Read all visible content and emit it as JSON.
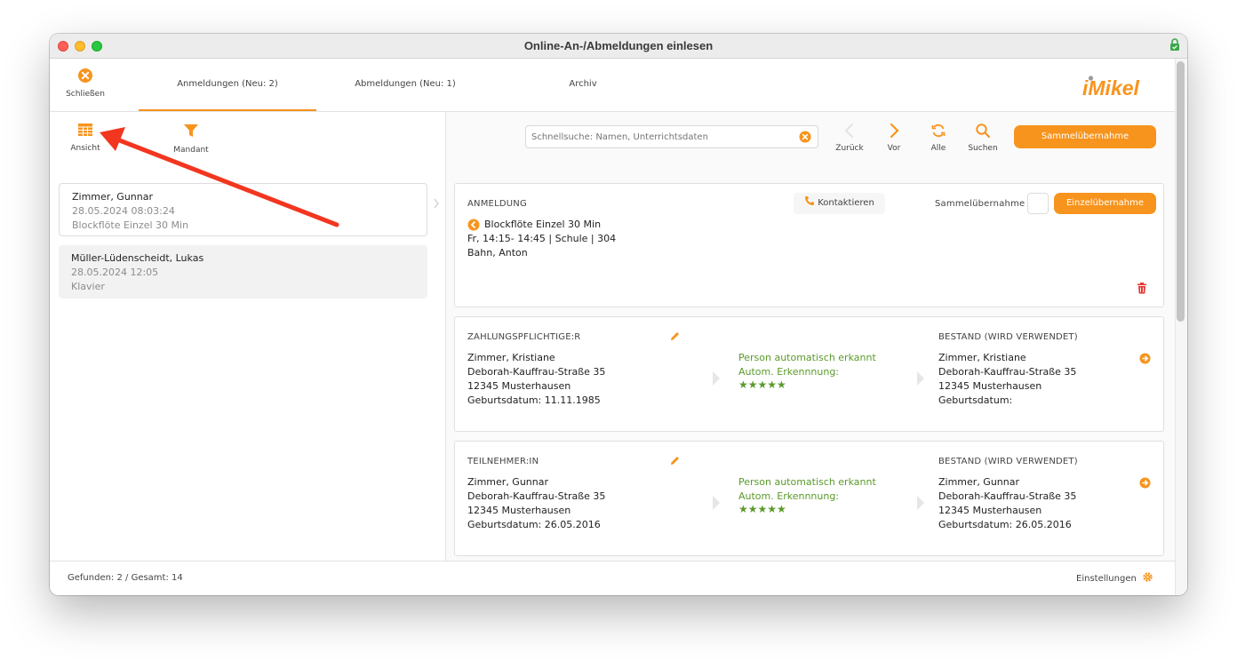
{
  "window": {
    "title": "Online-An-/Abmeldungen einlesen"
  },
  "topbar": {
    "close_label": "Schließen",
    "tabs": [
      {
        "label": "Anmeldungen (Neu: 2)",
        "active": true
      },
      {
        "label": "Abmeldungen (Neu: 1)",
        "active": false
      },
      {
        "label": "Archiv",
        "active": false
      }
    ],
    "logo_text": "iMikel"
  },
  "left_toolbar": {
    "view_label": "Ansicht",
    "filter_label": "Mandant"
  },
  "registrations": [
    {
      "name": "Zimmer, Gunnar",
      "date": "28.05.2024 08:03:24",
      "course": "Blockflöte Einzel 30 Min"
    },
    {
      "name": "Müller-Lüdenscheidt, Lukas",
      "date": "28.05.2024 12:05",
      "course": "Klavier"
    }
  ],
  "search": {
    "placeholder": "Schnellsuche: Namen, Unterrichtsdaten"
  },
  "nav": {
    "back_label": "Zurück",
    "forward_label": "Vor",
    "all_label": "Alle",
    "search_label": "Suchen",
    "bulk_transfer_label": "Sammelübernahme"
  },
  "registration_card": {
    "heading": "ANMELDUNG",
    "contact_label": "Kontaktieren",
    "bulk_label": "Sammelübernahme",
    "single_transfer_label": "Einzelübernahme",
    "course": "Blockflöte Einzel 30 Min",
    "schedule": "Fr, 14:15- 14:45 | Schule | 304",
    "teacher": "Bahn, Anton"
  },
  "payer_card": {
    "heading": "ZAHLUNGSPFLICHTIGE:R",
    "name": "Zimmer, Kristiane",
    "street": "Deborah-Kauffrau-Straße 35",
    "city": "12345 Musterhausen",
    "birth": "Geburtsdatum: 11.11.1985",
    "match_text": "Person automatisch erkannt",
    "match_label": "Autom. Erkennnung:",
    "stars": "★★★★★",
    "stock_heading": "BESTAND (WIRD VERWENDET)",
    "stock_name": "Zimmer, Kristiane",
    "stock_street": "Deborah-Kauffrau-Straße 35",
    "stock_city": "12345 Musterhausen",
    "stock_birth": "Geburtsdatum:"
  },
  "participant_card": {
    "heading": "TEILNEHMER:IN",
    "name": "Zimmer, Gunnar",
    "street": "Deborah-Kauffrau-Straße 35",
    "city": "12345 Musterhausen",
    "birth": "Geburtsdatum: 26.05.2016",
    "match_text": "Person automatisch erkannt",
    "match_label": "Autom. Erkennnung:",
    "stars": "★★★★★",
    "stock_heading": "BESTAND (WIRD VERWENDET)",
    "stock_name": "Zimmer, Gunnar",
    "stock_street": "Deborah-Kauffrau-Straße 35",
    "stock_city": "12345 Musterhausen",
    "stock_birth": "Geburtsdatum: 26.05.2016"
  },
  "statusbar": {
    "found_text": "Gefunden: 2 / Gesamt: 14",
    "settings_label": "Einstellungen"
  },
  "colors": {
    "accent": "#f7941d",
    "green": "#5a9a2a",
    "annotation_arrow": "#f2361f"
  }
}
